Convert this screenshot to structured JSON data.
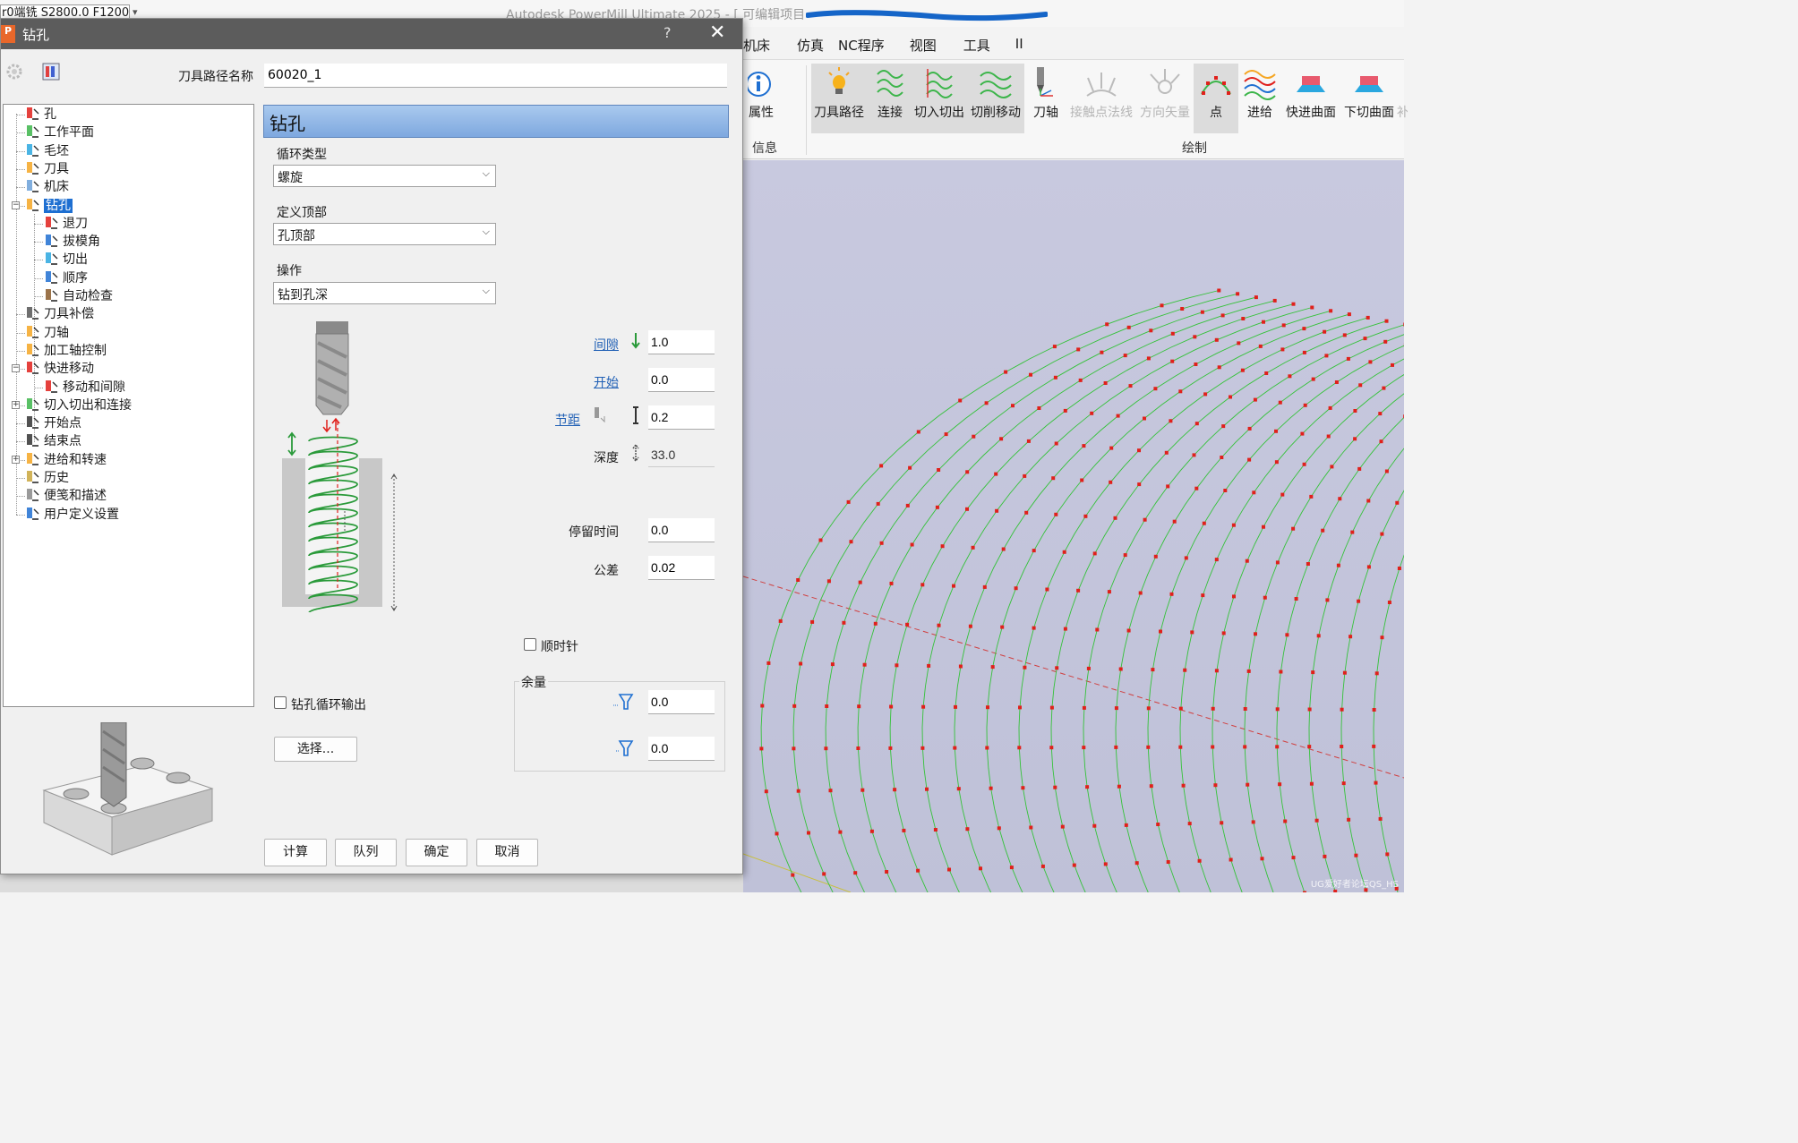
{
  "app": {
    "quick_access_value": "r0端铣 S2800.0 F1200",
    "title": "Autodesk PowerMill Ultimate 2025 - [ 可编辑项目",
    "menu": [
      "机床",
      "仿真",
      "NC程序",
      "视图",
      "工具",
      "II"
    ],
    "ribbon": {
      "info_button": "属性",
      "info_group": "信息",
      "draw_group": "绘制",
      "buttons": [
        "刀具路径",
        "连接",
        "切入切出",
        "切削移动",
        "刀轴",
        "接触点法线",
        "方向矢量",
        "点",
        "进给",
        "快进曲面",
        "下切曲面",
        "补"
      ]
    },
    "watermark": "UG爱好者论坛QS_HS"
  },
  "dialog": {
    "title": "钻孔",
    "help": "?",
    "close": "✕",
    "toolpath_name_label": "刀具路径名称",
    "toolpath_name_value": "60020_1",
    "tree": [
      {
        "label": "孔",
        "icon": "hole-icon"
      },
      {
        "label": "工作平面",
        "icon": "workplane-icon"
      },
      {
        "label": "毛坯",
        "icon": "block-icon"
      },
      {
        "label": "刀具",
        "icon": "tool-icon"
      },
      {
        "label": "机床",
        "icon": "machine-icon"
      },
      {
        "label": "钻孔",
        "icon": "drill-icon",
        "selected": true
      },
      {
        "label": "退刀",
        "icon": "retract-icon"
      },
      {
        "label": "拔模角",
        "icon": "draft-angle-icon"
      },
      {
        "label": "切出",
        "icon": "lead-out-icon"
      },
      {
        "label": "顺序",
        "icon": "order-icon"
      },
      {
        "label": "自动检查",
        "icon": "auto-check-icon"
      },
      {
        "label": "刀具补偿",
        "icon": "tool-compensation-icon"
      },
      {
        "label": "刀轴",
        "icon": "tool-axis-icon"
      },
      {
        "label": "加工轴控制",
        "icon": "axis-control-icon"
      },
      {
        "label": "快进移动",
        "icon": "rapid-move-icon"
      },
      {
        "label": "移动和间隙",
        "icon": "moves-gaps-icon"
      },
      {
        "label": "切入切出和连接",
        "icon": "leads-links-icon"
      },
      {
        "label": "开始点",
        "icon": "start-point-icon"
      },
      {
        "label": "结束点",
        "icon": "end-point-icon"
      },
      {
        "label": "进给和转速",
        "icon": "feeds-speeds-icon"
      },
      {
        "label": "历史",
        "icon": "history-icon"
      },
      {
        "label": "便笺和描述",
        "icon": "notes-icon"
      },
      {
        "label": "用户定义设置",
        "icon": "user-settings-icon"
      }
    ],
    "panel_title": "钻孔",
    "cycle_type_label": "循环类型",
    "cycle_type_value": "螺旋",
    "define_top_label": "定义顶部",
    "define_top_value": "孔顶部",
    "operation_label": "操作",
    "operation_value": "钻到孔深",
    "clearance_label": "间隙",
    "clearance_value": "1.0",
    "start_label": "开始",
    "start_value": "0.0",
    "pitch_label": "节距",
    "pitch_value": "0.2",
    "depth_label": "深度",
    "depth_value": "33.0",
    "dwell_label": "停留时间",
    "dwell_value": "0.0",
    "tolerance_label": "公差",
    "tolerance_value": "0.02",
    "clockwise_label": "顺时针",
    "cycle_output_label": "钻孔循环输出",
    "select_button": "选择...",
    "stock_group_label": "余量",
    "radial_stock_value": "0.0",
    "axial_stock_value": "0.0",
    "buttons": {
      "calculate": "计算",
      "queue": "队列",
      "ok": "确定",
      "cancel": "取消"
    }
  },
  "colors": {
    "selection": "#1e6fd1",
    "panel_header": "#8fb5e6",
    "link": "#1f5fb5",
    "mesh_green": "#35c23a",
    "mesh_point_red": "#e0201b"
  }
}
